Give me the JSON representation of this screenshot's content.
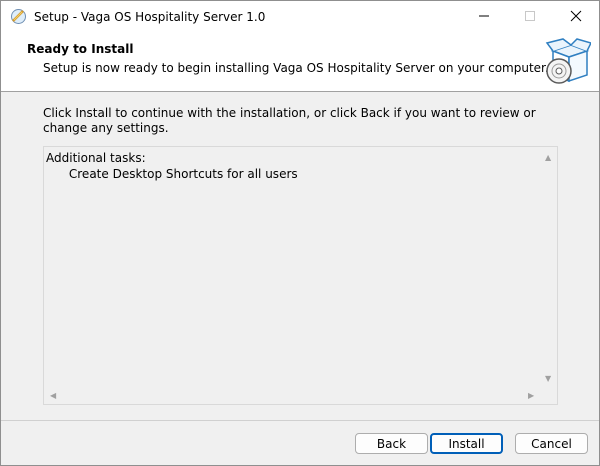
{
  "window": {
    "title": "Setup - Vaga OS Hospitality Server 1.0",
    "controls": [
      "minimize",
      "maximize",
      "close"
    ]
  },
  "header": {
    "title": "Ready to Install",
    "subtitle": "Setup is now ready to begin installing Vaga OS Hospitality Server on your computer."
  },
  "body": {
    "instructions": "Click Install to continue with the installation, or click Back if you want to review or change any settings.",
    "memo_lines": [
      "Additional tasks:",
      "      Create Desktop Shortcuts for all users"
    ]
  },
  "buttons": {
    "back": "Back",
    "install": "Install",
    "cancel": "Cancel"
  },
  "colors": {
    "accent": "#005fb8",
    "background": "#f0f0f0",
    "header_bg": "#ffffff"
  },
  "icons": {
    "app": "setup-app-icon",
    "header": "box-with-disc-icon"
  }
}
